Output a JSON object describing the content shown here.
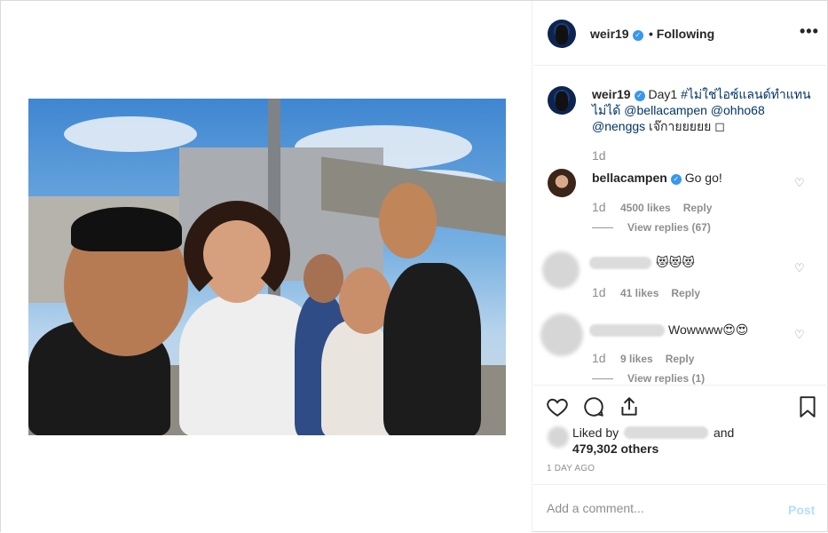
{
  "post": {
    "username": "weir19",
    "follow_status": "Following",
    "more_label": "•••"
  },
  "caption": {
    "username": "weir19",
    "text_start": "Day1",
    "hashtag": "#ไม่ใช่ไอซ์แลนด์ทำแทนไม่ได้",
    "mention1": "@bellacampen",
    "mention2": "@ohho68",
    "mention3": "@nenggs",
    "text_end": "เจ๊กายยยยย ◻",
    "time": "1d"
  },
  "comments": [
    {
      "username": "bellacampen",
      "text": "Go go!",
      "time": "1d",
      "likes": "4500 likes",
      "reply": "Reply",
      "view_replies": "View replies (67)"
    },
    {
      "username": "",
      "text": "😻😻😻",
      "time": "1d",
      "likes": "41 likes",
      "reply": "Reply"
    },
    {
      "username": "",
      "text": "Wowwww😍😍",
      "time": "1d",
      "likes": "9 likes",
      "reply": "Reply",
      "view_replies": "View replies (1)"
    }
  ],
  "likes": {
    "liked_by": "Liked by",
    "and": "and",
    "others": "479,302 others"
  },
  "timestamp": "1 DAY AGO",
  "add_comment": {
    "placeholder": "Add a comment...",
    "post_label": "Post"
  },
  "icons": {
    "like": "heart-icon",
    "comment": "comment-icon",
    "share": "share-icon",
    "save": "bookmark-icon",
    "more": "more-icon",
    "verified": "verified-badge-icon"
  },
  "colors": {
    "link": "#003569",
    "verified": "#3897f0",
    "muted": "#8e8e8e",
    "post_disabled": "#b2dffc"
  }
}
